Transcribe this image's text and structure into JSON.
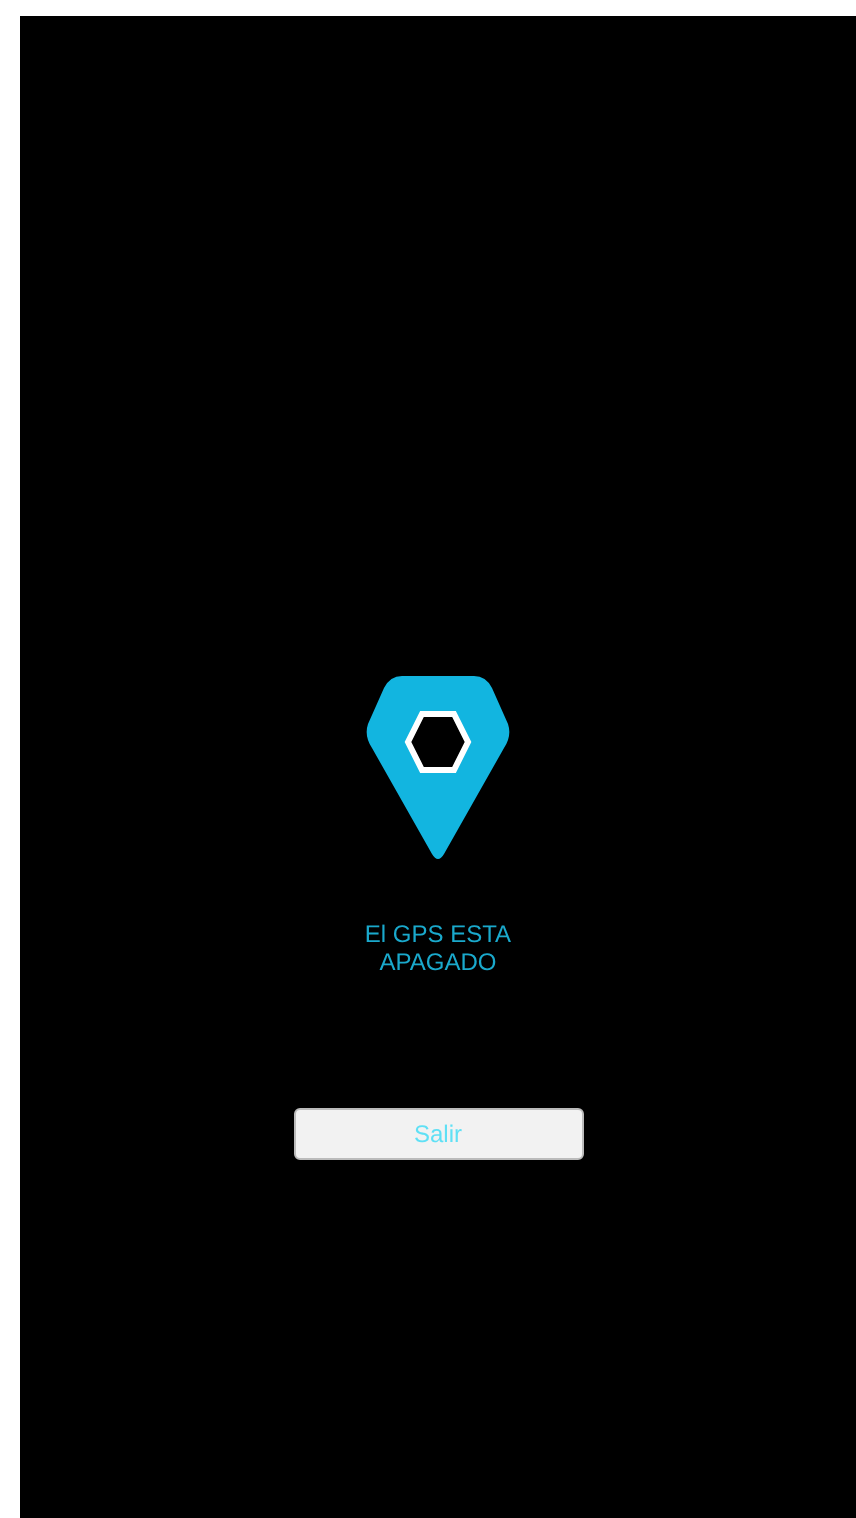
{
  "message": "El GPS ESTA APAGADO",
  "button": {
    "label": "Salir"
  }
}
